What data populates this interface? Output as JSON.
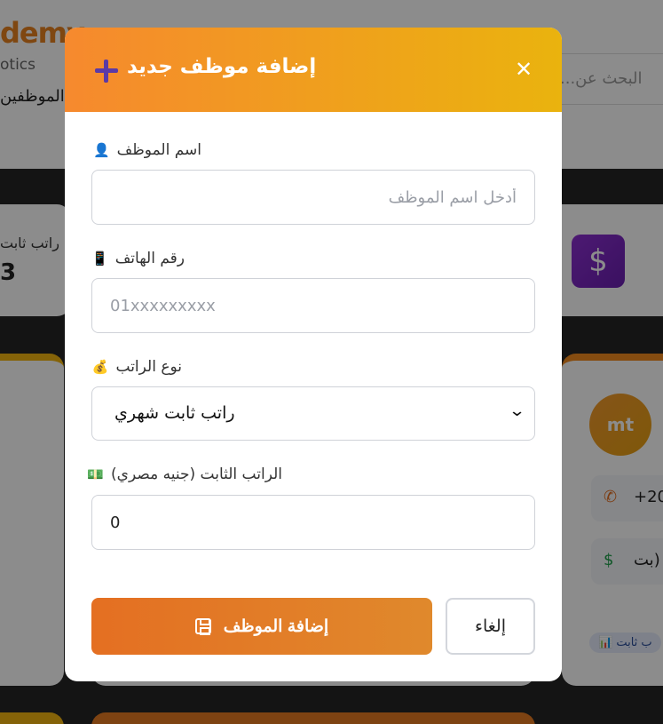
{
  "background": {
    "brand": "demy",
    "brand_sub": "otics",
    "nav_item": "الموظفين",
    "search_placeholder": "البحث عن...",
    "stat_label": "راتب ثابت",
    "stat_value": "3",
    "employee": {
      "avatar_initials": "mt",
      "phone": "+20",
      "salary_note": "بت)",
      "badge": "ب ثابت 📊"
    }
  },
  "modal": {
    "title": "إضافة موظف جديد",
    "fields": {
      "name": {
        "label": "اسم الموظف",
        "emoji": "👤",
        "placeholder": "أدخل اسم الموظف",
        "value": ""
      },
      "phone": {
        "label": "رقم الهاتف",
        "emoji": "📱",
        "placeholder": "01xxxxxxxxx",
        "value": ""
      },
      "salary_type": {
        "label": "نوع الراتب",
        "emoji": "💰",
        "selected": "راتب ثابت شهري"
      },
      "fixed_salary": {
        "label": "الراتب الثابت (جنيه مصري)",
        "emoji": "💵",
        "value": "0"
      }
    },
    "buttons": {
      "submit": "إضافة الموظف",
      "cancel": "إلغاء"
    }
  },
  "colors": {
    "header_start": "#f6892e",
    "header_end": "#eab30e",
    "submit": "#e46f22",
    "plus": "#5b3aa6"
  }
}
